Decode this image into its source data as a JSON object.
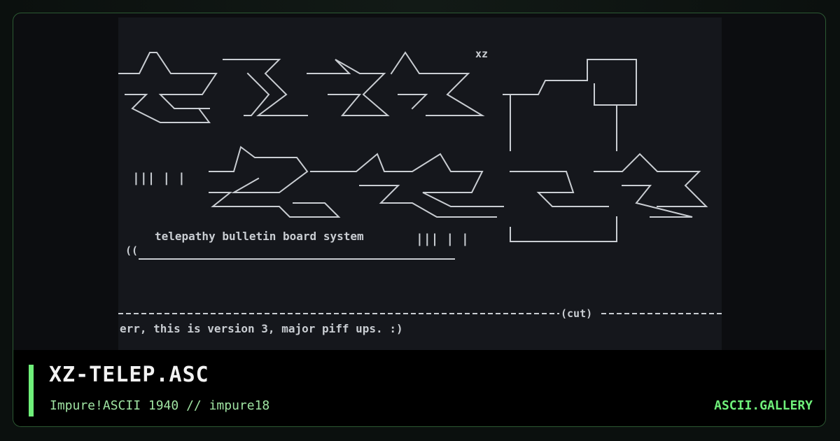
{
  "artwork": {
    "tagline": "telepathy bulletin board system",
    "cut_marker": "(cut)",
    "message": "err, this is version 3, major piff ups. :)",
    "prefix_mark": "((",
    "small_mark": "xz",
    "bar_marks": "||| | |"
  },
  "footer": {
    "title": "XZ-TELEP.ASC",
    "subtitle": "Impure!ASCII 1940 // impure18",
    "brand": "ASCII.GALLERY"
  },
  "colors": {
    "accent": "#6ff07a",
    "card_border": "#2c5a33",
    "preview_bg": "#15171c",
    "ascii_text": "#c9cdd2"
  }
}
